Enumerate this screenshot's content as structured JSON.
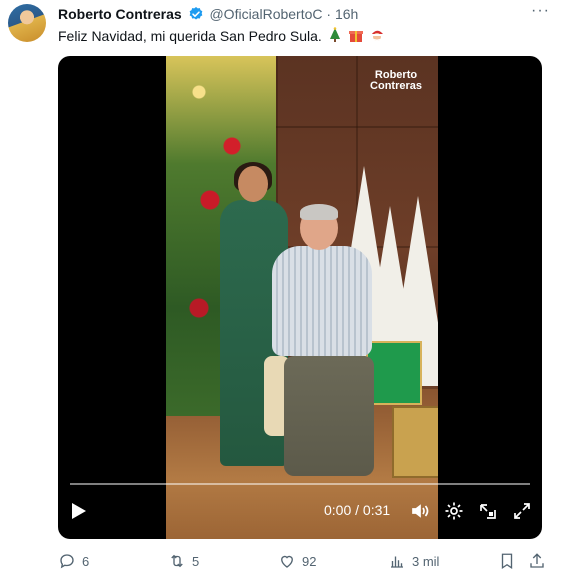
{
  "post": {
    "author_name": "Roberto Contreras",
    "handle": "@OficialRobertoC",
    "separator": "·",
    "time": "16h",
    "more_label": "···",
    "text": "Feliz Navidad, mi querida San Pedro Sula.",
    "emojis": [
      "christmas-tree-icon",
      "gift-icon",
      "santa-icon"
    ]
  },
  "video": {
    "watermark_line1": "Roberto",
    "watermark_line2": "Contreras",
    "time": "0:00 / 0:31",
    "progress_fraction": 0
  },
  "actions": {
    "replies": "6",
    "reposts": "5",
    "likes": "92",
    "views": "3 mil"
  },
  "colors": {
    "text_primary": "#0f1419",
    "text_secondary": "#536471",
    "verified": "#1d9bf0"
  }
}
